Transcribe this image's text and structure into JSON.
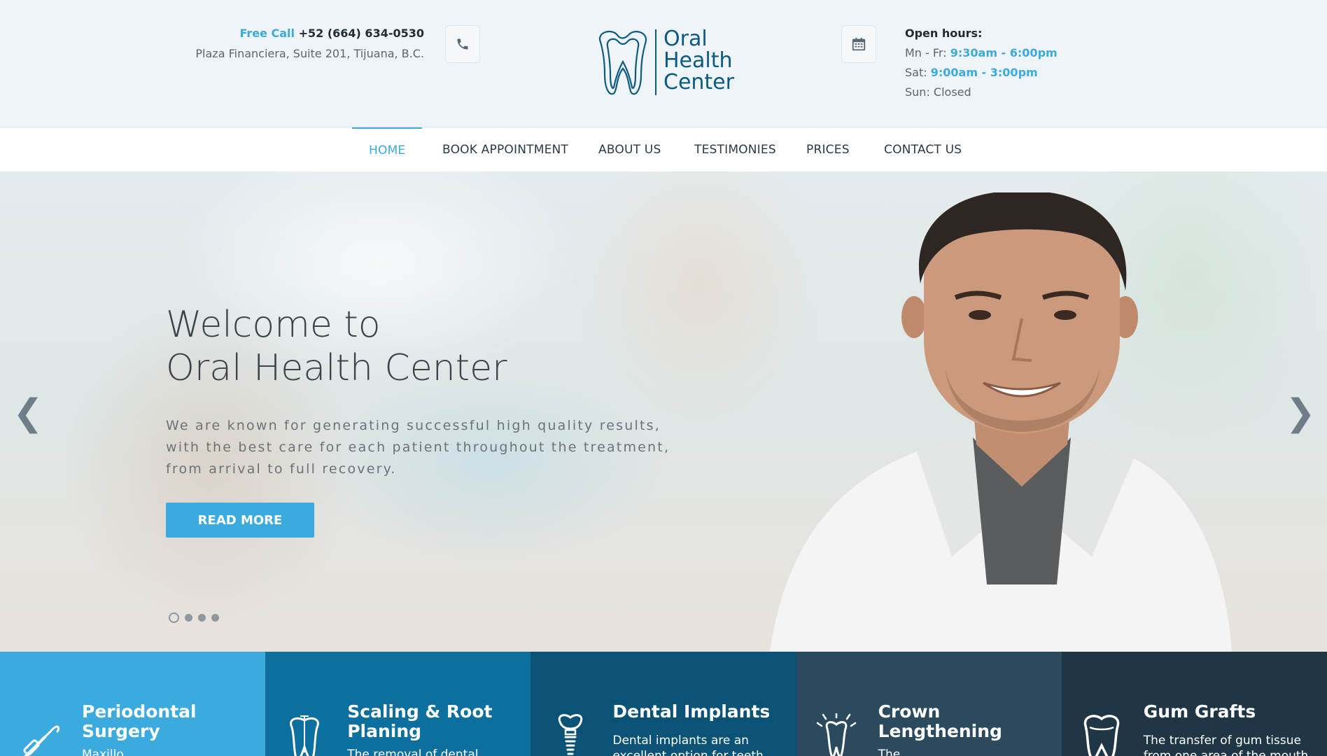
{
  "header": {
    "free_call_label": "Free Call",
    "phone": "+52 (664) 634-0530",
    "address": "Plaza Financiera, Suite 201, Tijuana, B.C.",
    "logo": {
      "line1": "Oral",
      "line2": "Health",
      "line3": "Center"
    },
    "hours": {
      "title": "Open hours:",
      "weekday_label": "Mn - Fr:",
      "weekday_time": "9:30am - 6:00pm",
      "saturday_label": "Sat:",
      "saturday_time": "9:00am - 3:00pm",
      "sunday": "Sun: Closed"
    }
  },
  "nav": {
    "items": [
      {
        "label": "HOME",
        "active": true
      },
      {
        "label": "BOOK APPOINTMENT"
      },
      {
        "label": "ABOUT US"
      },
      {
        "label": "TESTIMONIES"
      },
      {
        "label": "PRICES"
      },
      {
        "label": "CONTACT US"
      }
    ]
  },
  "hero": {
    "title_line1": "Welcome to",
    "title_line2": "Oral Health Center",
    "description": "We are known for generating successful high quality results, with the best care for each patient throughout the treatment, from arrival to full recovery.",
    "button": "READ MORE",
    "prev_arrow": "❮",
    "next_arrow": "❯",
    "slide_count": 4,
    "active_slide": 1
  },
  "services": [
    {
      "title_line1": "Periodontal",
      "title_line2": "Surgery",
      "text": "Maxillo ...",
      "color": "#3aaadf",
      "icon": "dental-tool-icon"
    },
    {
      "title_line1": "Scaling & Root",
      "title_line2": "Planing",
      "text": "The removal of dental ...",
      "color": "#0d6f9e",
      "icon": "tooth-root-icon"
    },
    {
      "title_line1": "Dental Implants",
      "title_line2": "",
      "text": "Dental implants are an excellent option for teeth",
      "color": "#0a5377",
      "icon": "implant-icon"
    },
    {
      "title_line1": "Crown",
      "title_line2": "Lengthening",
      "text": "The ...",
      "color": "#2c4a5e",
      "icon": "shining-tooth-icon"
    },
    {
      "title_line1": "Gum Grafts",
      "title_line2": "",
      "text": "The transfer of gum tissue from one area of the mouth",
      "color": "#1f3647",
      "icon": "tooth-icon"
    }
  ],
  "colors": {
    "accent": "#3aaadf",
    "logo_blue": "#0b5a82",
    "header_bg": "#eef4f8"
  }
}
